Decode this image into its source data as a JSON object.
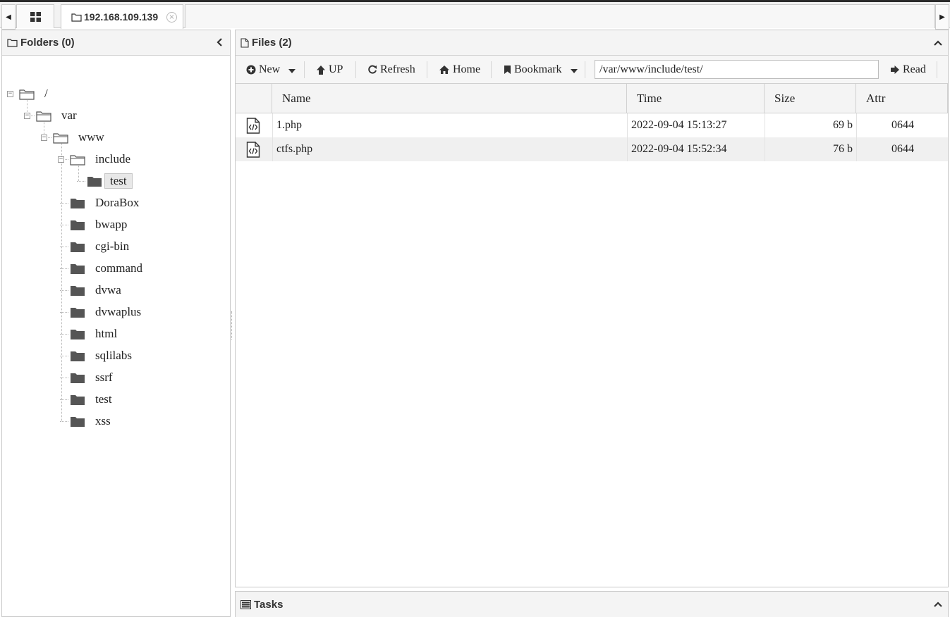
{
  "tabs": {
    "grid_icon": "grid-icon",
    "active_tab": {
      "label": "192.168.109.139",
      "icon": "folder-icon",
      "close": "×"
    }
  },
  "folders_panel": {
    "title": "Folders (0)",
    "tree": [
      {
        "label": "/",
        "state": "expanded"
      },
      {
        "label": "var",
        "state": "expanded"
      },
      {
        "label": "www",
        "state": "expanded"
      },
      {
        "label": "include",
        "state": "expanded"
      },
      {
        "label": "test",
        "state": "selected"
      },
      {
        "label": "DoraBox"
      },
      {
        "label": "bwapp"
      },
      {
        "label": "cgi-bin"
      },
      {
        "label": "command"
      },
      {
        "label": "dvwa"
      },
      {
        "label": "dvwaplus"
      },
      {
        "label": "html"
      },
      {
        "label": "sqlilabs"
      },
      {
        "label": "ssrf"
      },
      {
        "label": "test"
      },
      {
        "label": "xss"
      }
    ]
  },
  "files_panel": {
    "title": "Files (2)",
    "toolbar": {
      "new": "New",
      "up": "UP",
      "refresh": "Refresh",
      "home": "Home",
      "bookmark": "Bookmark",
      "path": "/var/www/include/test/",
      "read": "Read"
    },
    "columns": {
      "name": "Name",
      "time": "Time",
      "size": "Size",
      "attr": "Attr"
    },
    "files": [
      {
        "name": "1.php",
        "time": "2022-09-04 15:13:27",
        "size": "69 b",
        "attr": "0644"
      },
      {
        "name": "ctfs.php",
        "time": "2022-09-04 15:52:34",
        "size": "76 b",
        "attr": "0644"
      }
    ]
  },
  "tasks_panel": {
    "title": "Tasks"
  }
}
